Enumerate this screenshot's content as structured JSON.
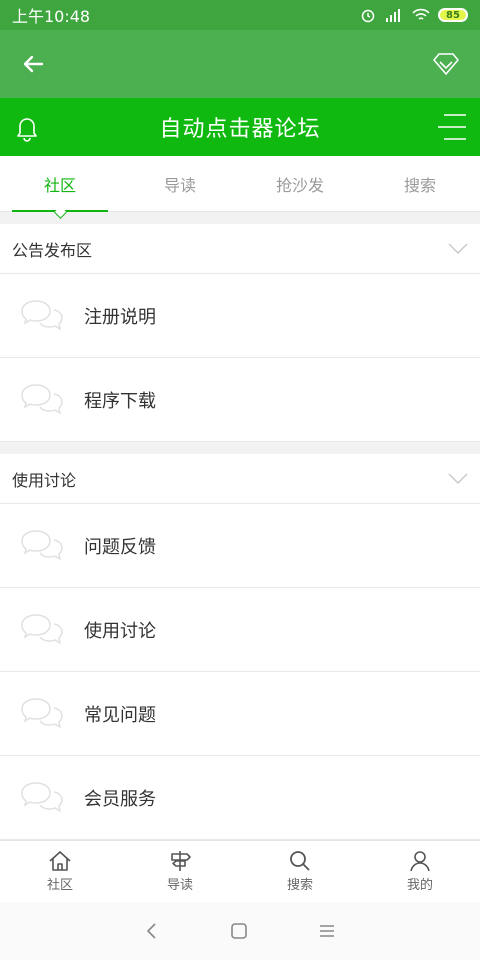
{
  "status_bar": {
    "time": "上午10:48",
    "battery": "85"
  },
  "title_bar": {
    "title": "自动点击器论坛"
  },
  "tabs": [
    {
      "label": "社区",
      "active": true
    },
    {
      "label": "导读",
      "active": false
    },
    {
      "label": "抢沙发",
      "active": false
    },
    {
      "label": "搜索",
      "active": false
    }
  ],
  "sections": [
    {
      "title": "公告发布区",
      "items": [
        {
          "label": "注册说明"
        },
        {
          "label": "程序下载"
        }
      ]
    },
    {
      "title": "使用讨论",
      "items": [
        {
          "label": "问题反馈"
        },
        {
          "label": "使用讨论"
        },
        {
          "label": "常见问题"
        },
        {
          "label": "会员服务"
        }
      ]
    }
  ],
  "bottom_nav": [
    {
      "label": "社区",
      "icon": "home-icon"
    },
    {
      "label": "导读",
      "icon": "signpost-icon"
    },
    {
      "label": "搜索",
      "icon": "search-icon"
    },
    {
      "label": "我的",
      "icon": "user-icon"
    }
  ],
  "colors": {
    "status_bar": "#3fa63f",
    "top_bar": "#4caf50",
    "title_bar": "#0fb90f",
    "accent": "#11b511"
  }
}
